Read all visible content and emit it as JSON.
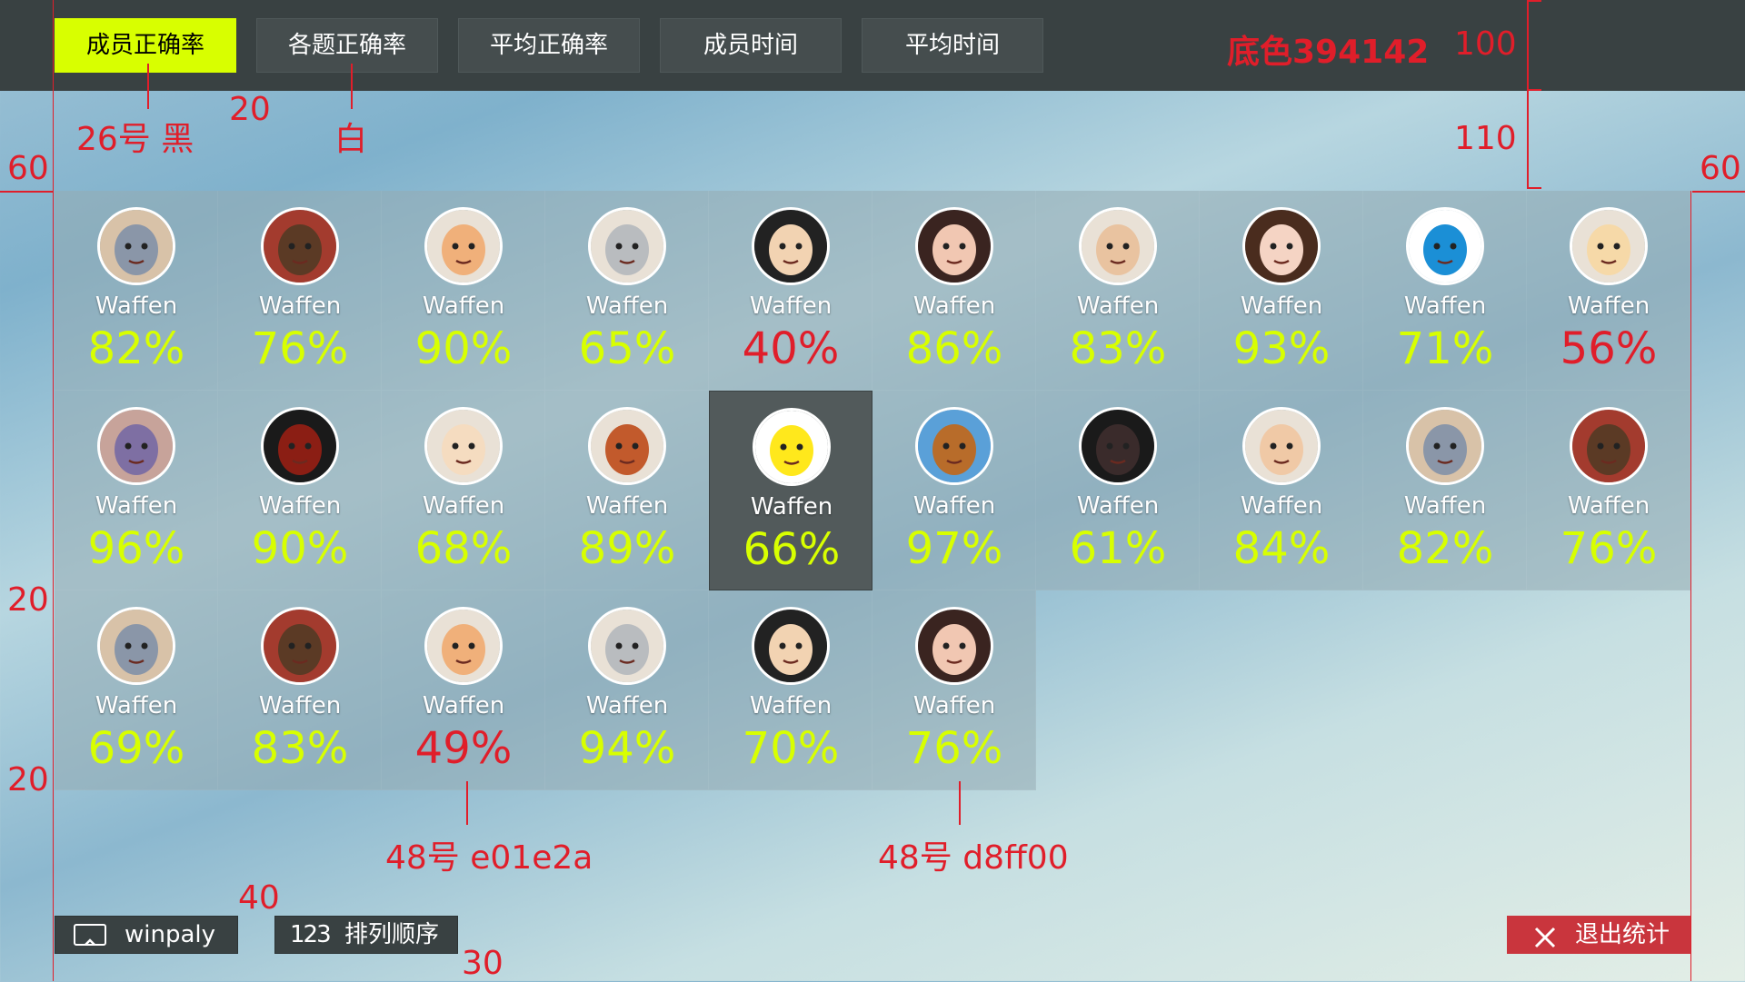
{
  "theme": {
    "accent": "#d8ff00",
    "low": "#e01e2a",
    "bar": "#394142"
  },
  "tabs": [
    {
      "label": "成员正确率",
      "active": true
    },
    {
      "label": "各题正确率",
      "active": false
    },
    {
      "label": "平均正确率",
      "active": false
    },
    {
      "label": "成员时间",
      "active": false
    },
    {
      "label": "平均时间",
      "active": false
    }
  ],
  "annotations": {
    "bg_color": "底色394142",
    "bar_height": "100",
    "top_gap": "110",
    "left_margin": "60",
    "right_margin": "60",
    "tab_gap": "20",
    "tab_font": "26号  黑",
    "tab_font_inactive": "白",
    "row_gap_1": "20",
    "row_gap_2": "20",
    "pct_low": "48号  e01e2a",
    "pct_high": "48号  d8ff00",
    "bottom_gap": "40",
    "bottom_margin": "30"
  },
  "members": [
    {
      "name": "Waffen",
      "percent": "82%",
      "avatar": "cat-avatar",
      "low": false
    },
    {
      "name": "Waffen",
      "percent": "76%",
      "avatar": "glasses-man-avatar",
      "low": false
    },
    {
      "name": "Waffen",
      "percent": "90%",
      "avatar": "face-avatar",
      "low": false
    },
    {
      "name": "Waffen",
      "percent": "65%",
      "avatar": "statue-avatar",
      "low": false
    },
    {
      "name": "Waffen",
      "percent": "40%",
      "avatar": "nerd-avatar",
      "low": true
    },
    {
      "name": "Waffen",
      "percent": "86%",
      "avatar": "woman-avatar",
      "low": false
    },
    {
      "name": "Waffen",
      "percent": "83%",
      "avatar": "boy-glasses-avatar",
      "low": false
    },
    {
      "name": "Waffen",
      "percent": "93%",
      "avatar": "girl-avatar",
      "low": false
    },
    {
      "name": "Waffen",
      "percent": "71%",
      "avatar": "doraemon-avatar",
      "low": false
    },
    {
      "name": "Waffen",
      "percent": "56%",
      "avatar": "kid-avatar",
      "low": true
    },
    {
      "name": "Waffen",
      "percent": "96%",
      "avatar": "mio-avatar",
      "low": false
    },
    {
      "name": "Waffen",
      "percent": "90%",
      "avatar": "ironman-avatar",
      "low": false
    },
    {
      "name": "Waffen",
      "percent": "68%",
      "avatar": "cartoon-glasses-avatar",
      "low": false
    },
    {
      "name": "Waffen",
      "percent": "89%",
      "avatar": "ratatouille-avatar",
      "low": false
    },
    {
      "name": "Waffen",
      "percent": "66%",
      "avatar": "helmet-avatar",
      "low": false,
      "selected": true
    },
    {
      "name": "Waffen",
      "percent": "97%",
      "avatar": "dog-avatar",
      "low": false
    },
    {
      "name": "Waffen",
      "percent": "61%",
      "avatar": "vulture-avatar",
      "low": false
    },
    {
      "name": "Waffen",
      "percent": "84%",
      "avatar": "smile-glasses-avatar",
      "low": false
    },
    {
      "name": "Waffen",
      "percent": "82%",
      "avatar": "cat-avatar",
      "low": false
    },
    {
      "name": "Waffen",
      "percent": "76%",
      "avatar": "glasses-man-avatar",
      "low": false
    },
    {
      "name": "Waffen",
      "percent": "69%",
      "avatar": "cat-avatar",
      "low": false
    },
    {
      "name": "Waffen",
      "percent": "83%",
      "avatar": "glasses-man-avatar",
      "low": false
    },
    {
      "name": "Waffen",
      "percent": "49%",
      "avatar": "face-avatar",
      "low": true
    },
    {
      "name": "Waffen",
      "percent": "94%",
      "avatar": "statue-avatar",
      "low": false
    },
    {
      "name": "Waffen",
      "percent": "70%",
      "avatar": "nerd-avatar",
      "low": false
    },
    {
      "name": "Waffen",
      "percent": "76%",
      "avatar": "woman-avatar",
      "low": false
    }
  ],
  "bottom": {
    "winplay_label": "winpaly",
    "sort_icon_text": "123",
    "sort_label": "排列顺序",
    "exit_label": "退出统计"
  }
}
